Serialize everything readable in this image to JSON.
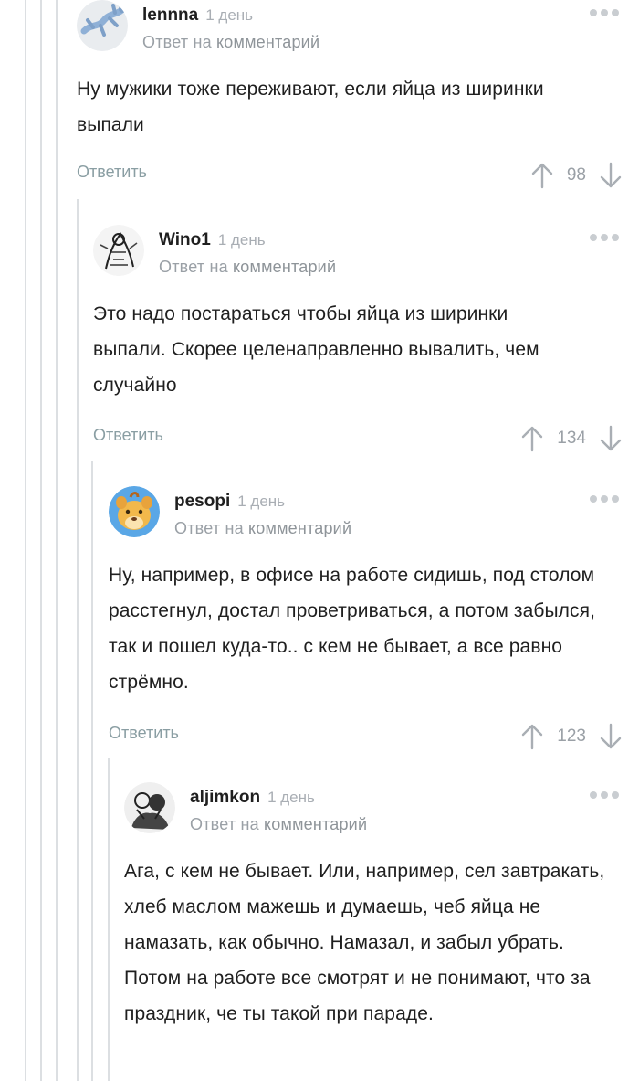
{
  "comments": [
    {
      "author": "lennna",
      "time": "1 день",
      "reply_prefix": "Ответ на",
      "reply_link": "комментарий",
      "text": "Ну мужики тоже переживают, если яйца из ширинки выпали",
      "reply_label": "Ответить",
      "score": "98",
      "avatar_icon": "lizard-avatar-icon"
    },
    {
      "author": "Wino1",
      "time": "1 день",
      "reply_prefix": "Ответ на",
      "reply_link": "комментарий",
      "text": "Это надо постараться чтобы яйца из ширинки выпали. Скорее целенаправленно вывалить, чем случайно",
      "reply_label": "Ответить",
      "score": "134",
      "avatar_icon": "sketch-avatar-icon"
    },
    {
      "author": "pesopi",
      "time": "1 день",
      "reply_prefix": "Ответ на",
      "reply_link": "комментарий",
      "text": "Ну, например, в офисе на работе сидишь, под столом расстегнул, достал проветриваться, а потом забылся, так и пошел куда-то.. с кем не бывает, а все равно стрёмно.",
      "reply_label": "Ответить",
      "score": "123",
      "avatar_icon": "lion-cub-avatar-icon"
    },
    {
      "author": "aljimkon",
      "time": "1 день",
      "reply_prefix": "Ответ на",
      "reply_link": "комментарий",
      "text": "Ага, с кем не бывает. Или, например, сел завтракать, хлеб маслом мажешь и думаешь, чеб яйца не намазать, как обычно. Намазал, и забыл убрать. Потом на работе все смотрят и не понимают, что за праздник, че ты такой при параде.",
      "avatar_icon": "bw-portrait-avatar-icon"
    }
  ],
  "colors": {
    "accent_link": "#8a9ea3",
    "thread_line": "#dcdfe2",
    "muted": "#9aa0a6"
  }
}
